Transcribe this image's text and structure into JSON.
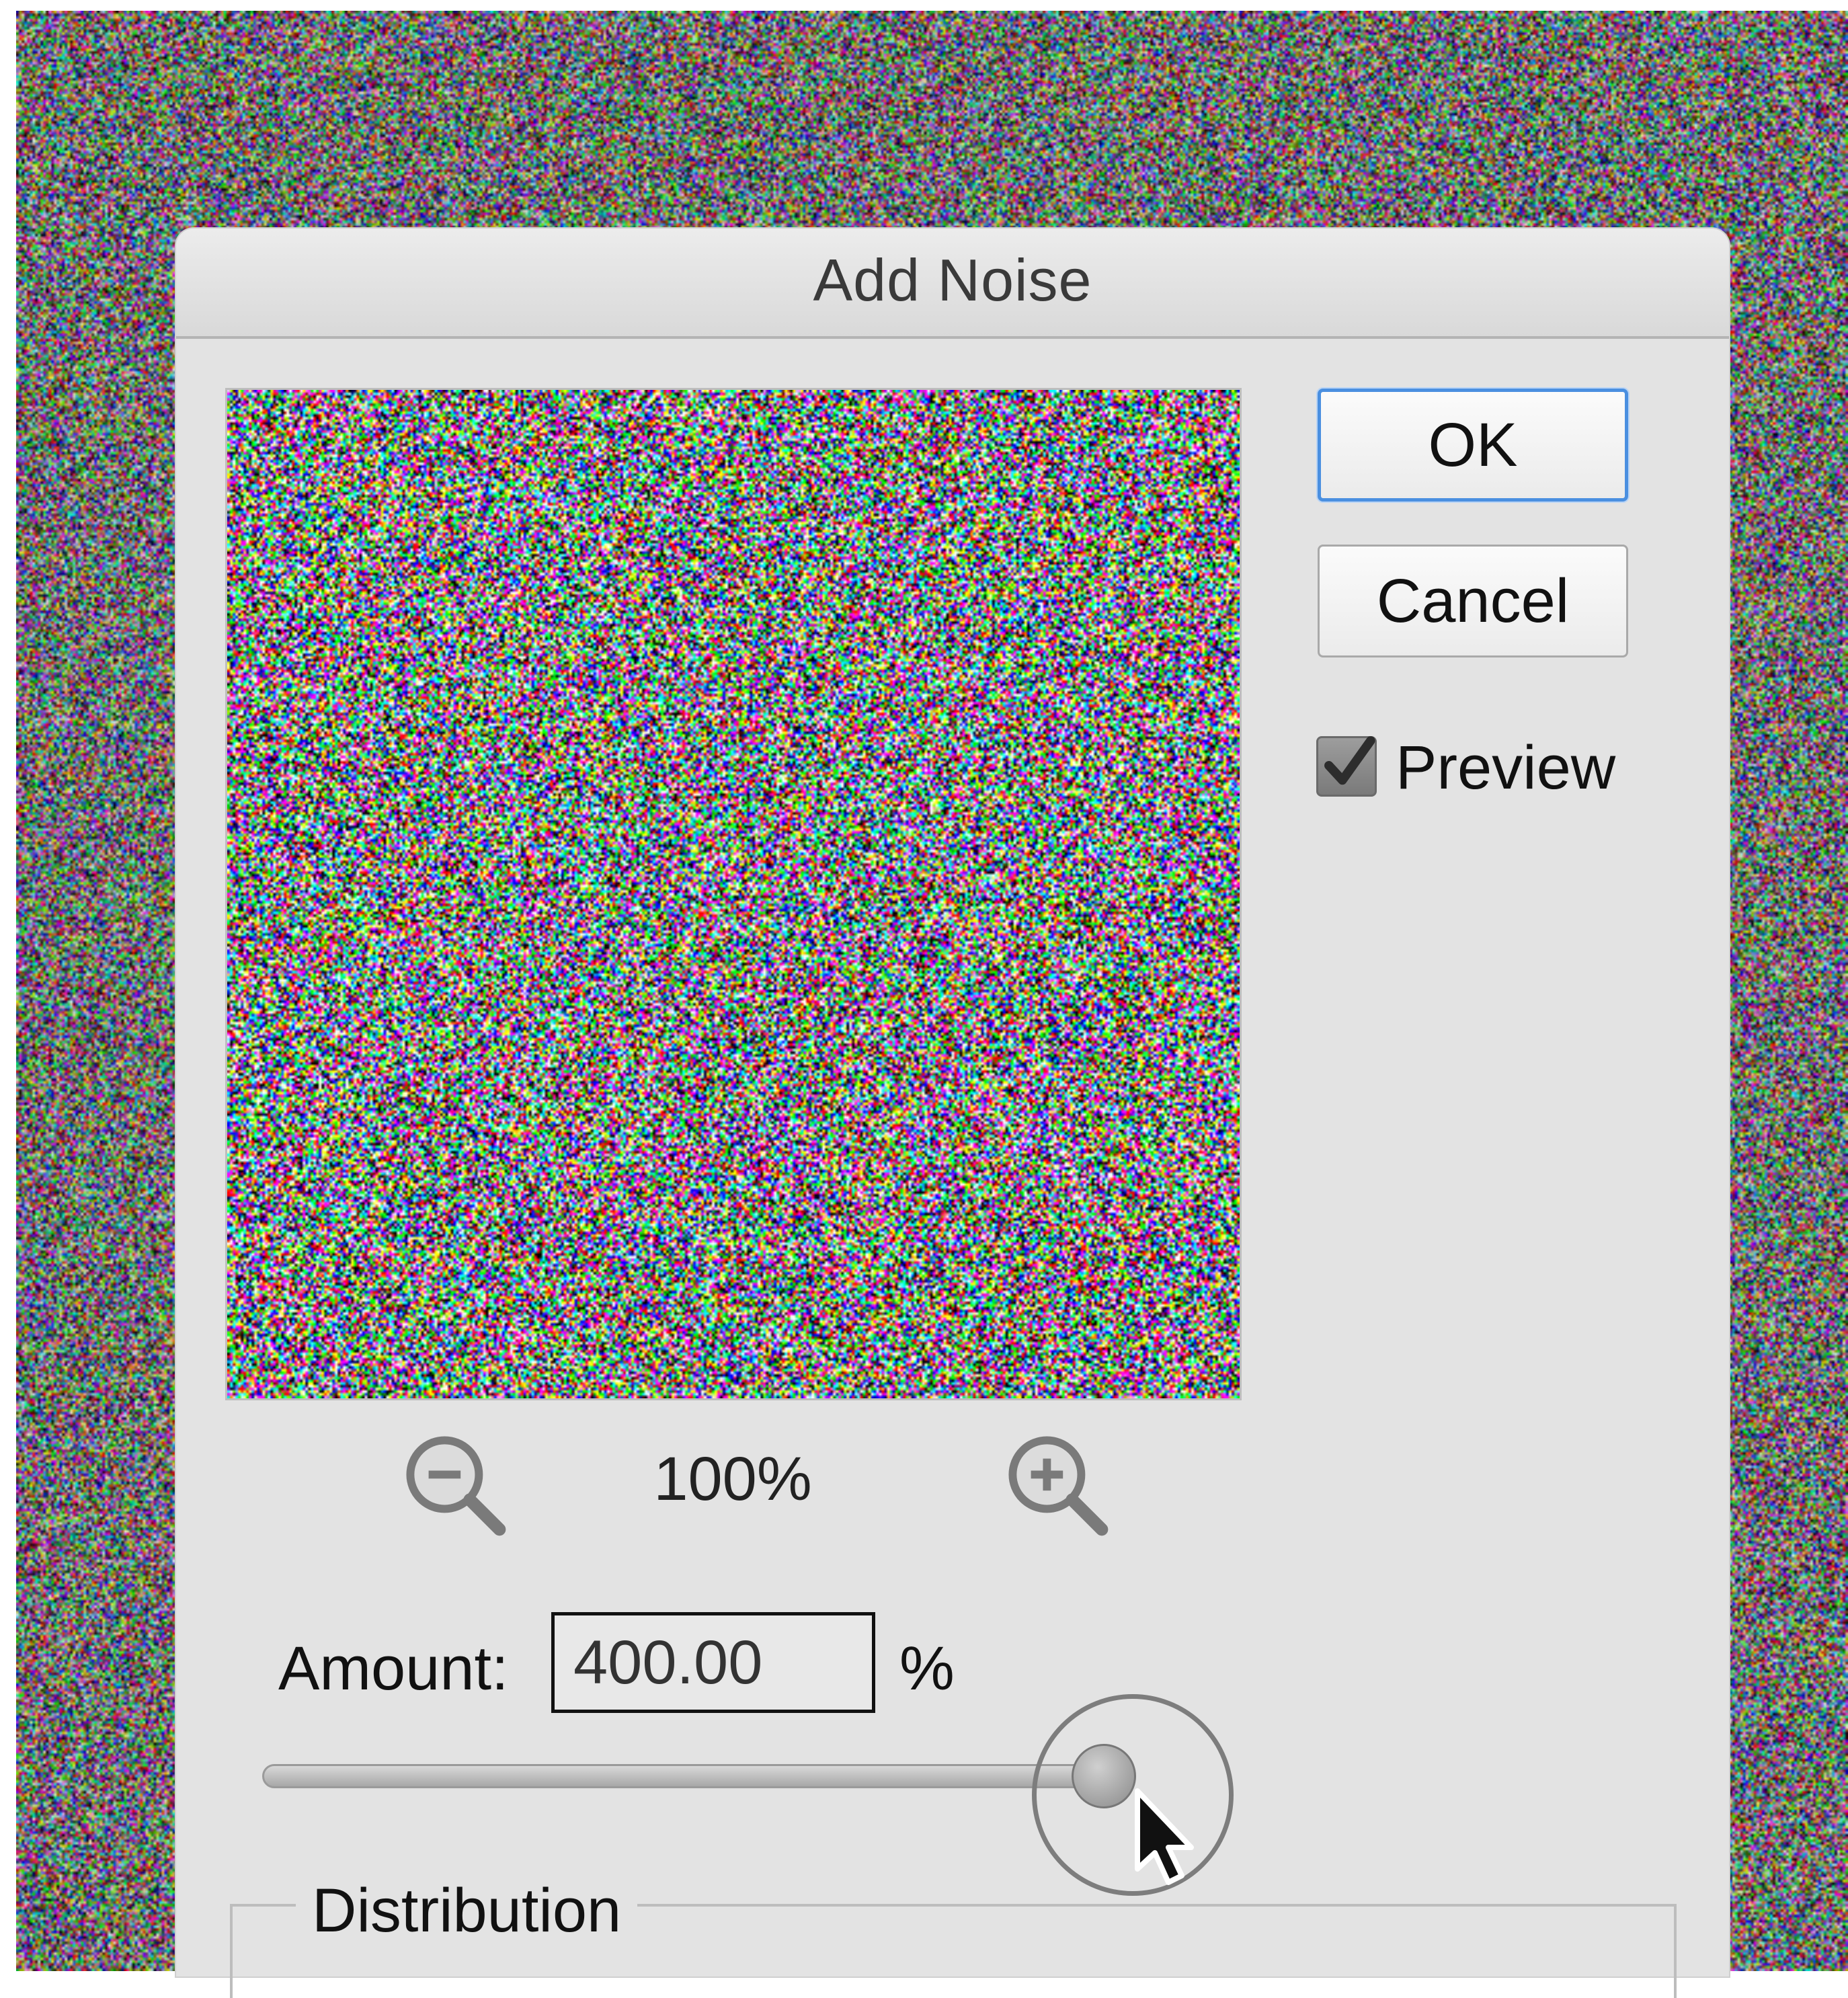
{
  "dialog": {
    "title": "Add Noise",
    "preview_zoom": "100%",
    "buttons": {
      "ok": "OK",
      "cancel": "Cancel"
    },
    "preview_checkbox": {
      "label": "Preview",
      "checked": true
    },
    "amount": {
      "label": "Amount:",
      "value": "400.00",
      "unit": "%",
      "slider_fraction": 1.0
    },
    "distribution": {
      "group_label": "Distribution"
    }
  },
  "icons": {
    "zoom_out": "zoom-out-icon",
    "zoom_in": "zoom-in-icon",
    "cursor": "mouse-pointer-icon",
    "check": "checkmark-icon"
  },
  "colors": {
    "dialog_bg": "#e3e3e3",
    "default_button_border": "#4a8fe0",
    "noise_palette": [
      "#ff0000",
      "#00ff00",
      "#0000ff",
      "#ffff00",
      "#ff00ff",
      "#00ffff",
      "#ffffff",
      "#000000"
    ]
  }
}
